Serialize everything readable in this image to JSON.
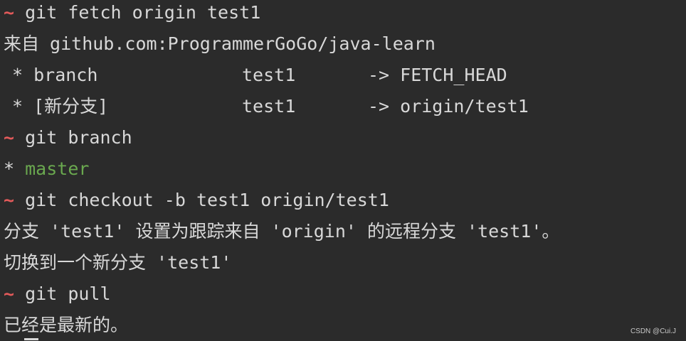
{
  "prompt_symbol": "~",
  "lines": {
    "cmd_fetch": "git fetch origin test1",
    "from_remote": "来自 github.com:ProgrammerGoGo/java-learn",
    "fetch_row1": {
      "col1": "* branch",
      "col2": "test1",
      "col3": "-> FETCH_HEAD"
    },
    "fetch_row2": {
      "col1": "* [新分支]",
      "col2": "test1",
      "col3": "-> origin/test1"
    },
    "cmd_branch": "git branch",
    "branch_star": "* ",
    "branch_current": "master",
    "cmd_checkout": "git checkout -b test1 origin/test1",
    "tracking_msg": "分支 'test1' 设置为跟踪来自 'origin' 的远程分支 'test1'。",
    "switched_msg": "切换到一个新分支 'test1'",
    "cmd_pull": "git pull",
    "up_to_date": "已经是最新的。"
  },
  "watermark": "CSDN @Cui.J",
  "colors": {
    "background": "#2b2b2b",
    "text": "#d8d8d8",
    "prompt": "#e25a5a",
    "current_branch": "#6aa84f"
  }
}
